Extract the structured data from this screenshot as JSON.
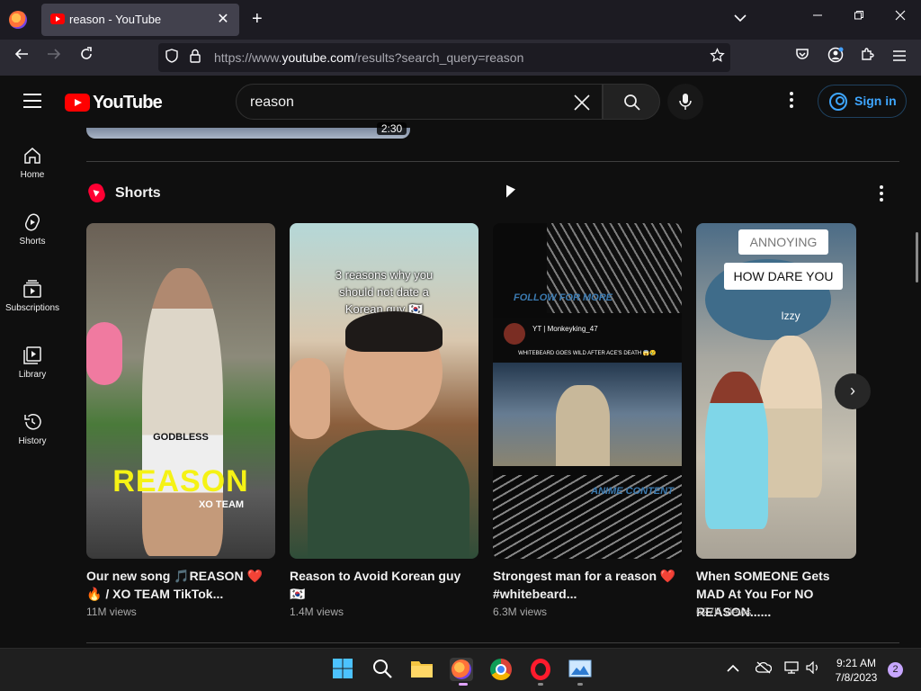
{
  "browser": {
    "tab_title": "reason - YouTube",
    "tab_close": "✕",
    "new_tab": "+",
    "url_prefix": "https://www.",
    "url_domain": "youtube.com",
    "url_suffix": "/results?search_query=reason"
  },
  "youtube": {
    "logo_text": "YouTube",
    "search_value": "reason",
    "sign_in_label": "Sign in"
  },
  "sidebar": {
    "items": [
      {
        "label": "Home",
        "icon": "home-icon"
      },
      {
        "label": "Shorts",
        "icon": "shorts-icon"
      },
      {
        "label": "Subscriptions",
        "icon": "subscriptions-icon"
      },
      {
        "label": "Library",
        "icon": "library-icon"
      },
      {
        "label": "History",
        "icon": "history-icon"
      }
    ]
  },
  "previous_video": {
    "duration": "2:30"
  },
  "shorts": {
    "heading": "Shorts",
    "items": [
      {
        "title": "Our new song 🎵REASON ❤️🔥 / XO TEAM TikTok...",
        "views": "11M views",
        "overlay_text": "GODBLESS",
        "overlay_big": "REASON",
        "overlay_small": "XO TEAM"
      },
      {
        "title": "Reason to Avoid Korean guy 🇰🇷",
        "views": "1.4M views",
        "overlay_text": "3 reasons why you should not date a Korean guy 🇰🇷"
      },
      {
        "title": "Strongest man for a reason ❤️ #whitebeard...",
        "views": "6.3M views",
        "overlay_top": "FOLLOW FOR MORE",
        "overlay_user": "YT | Monkeyking_47",
        "overlay_caption": "WHITEBEARD GOES WILD AFTER ACE'S DEATH 😱😢",
        "overlay_bottom": "ANIME CONTENT"
      },
      {
        "title": "When SOMEONE Gets MAD At You For NO REASON......",
        "views": "627K views",
        "overlay_top": "ANNOYING",
        "overlay_mid": "HOW DARE YOU",
        "overlay_name": "Izzy"
      }
    ]
  },
  "taskbar": {
    "time": "9:21 AM",
    "date": "7/8/2023",
    "notifications": "2"
  },
  "colors": {
    "youtube_red": "#ff0000",
    "link_blue": "#3ea6ff",
    "background": "#0f0f0f"
  }
}
